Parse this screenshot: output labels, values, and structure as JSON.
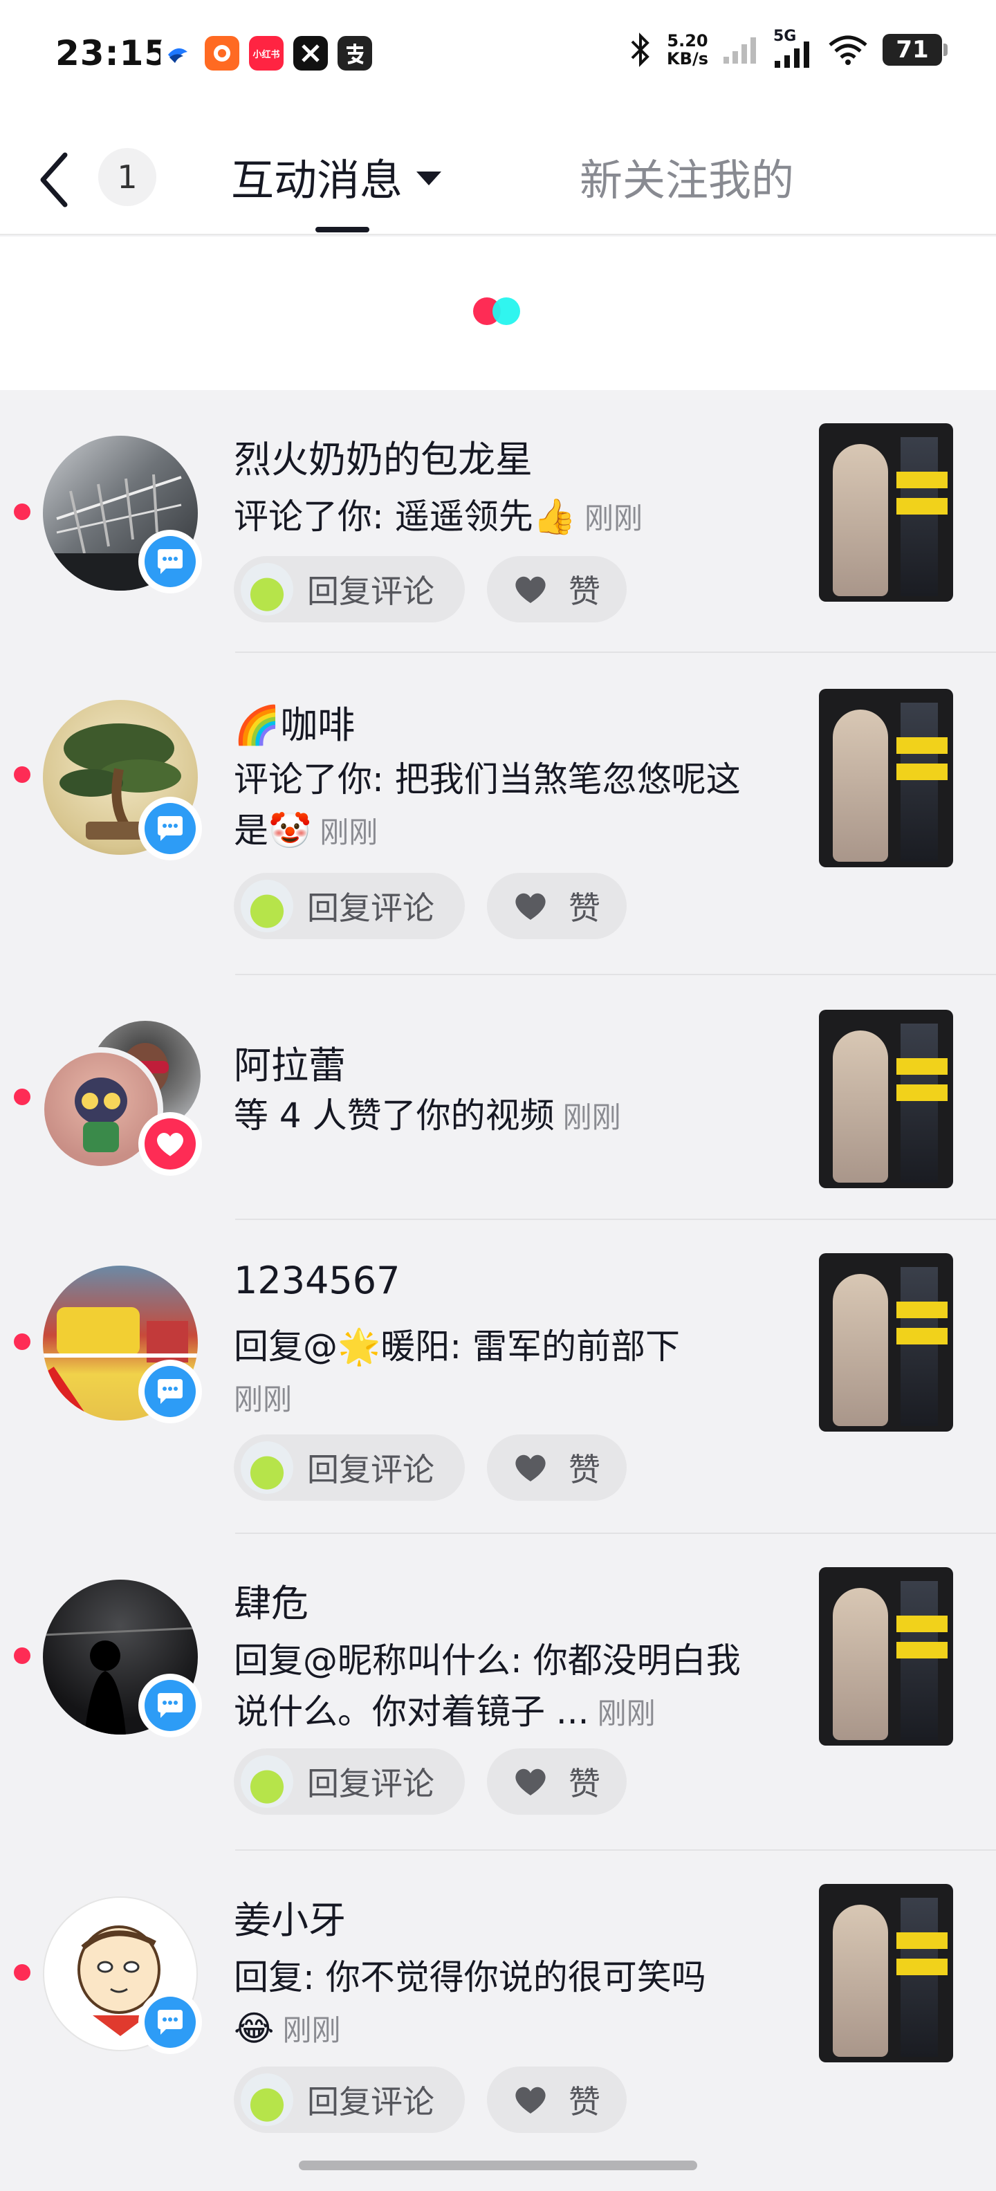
{
  "status_bar": {
    "time": "23:15",
    "app_icons": [
      "ticket-app-icon",
      "orange-app-icon",
      "小红书",
      "x-app-icon",
      "alipay-icon"
    ],
    "network_speed_value": "5.20",
    "network_speed_unit": "KB/s",
    "network_type": "5G",
    "battery": "71"
  },
  "header": {
    "unread_count": "1",
    "active_tab": "互动消息",
    "inactive_tab": "新关注我的"
  },
  "colors": {
    "accent_red": "#fe2c55",
    "accent_cyan": "#25f4ee",
    "badge_blue": "#2d9cf6"
  },
  "notifications": [
    {
      "name": "烈火奶奶的包龙星",
      "message": "评论了你: 遥遥领先",
      "message_emoji": "👍",
      "time": "刚刚",
      "badge": "comment",
      "reply_label": "回复评论",
      "like_label": "赞"
    },
    {
      "name": "咖啡",
      "name_emoji": "🌈",
      "message": "评论了你: 把我们当煞笔忽悠呢这是",
      "message_emoji": "🤡",
      "time": "刚刚",
      "badge": "comment",
      "reply_label": "回复评论",
      "like_label": "赞"
    },
    {
      "name": "阿拉蕾",
      "message": "等 4 人赞了你的视频",
      "time": "刚刚",
      "badge": "like"
    },
    {
      "name": "1234567",
      "message_prefix": "回复@",
      "message_emoji": "🌟",
      "message": "暖阳: 雷军的前部下",
      "time": "刚刚",
      "badge": "comment",
      "reply_label": "回复评论",
      "like_label": "赞"
    },
    {
      "name": "肆危",
      "message": "回复@昵称叫什么: 你都没明白我说什么。你对着镜子 ...",
      "time": "刚刚",
      "badge": "comment",
      "reply_label": "回复评论",
      "like_label": "赞"
    },
    {
      "name": "姜小牙",
      "message": "回复: 你不觉得你说的很可笑吗",
      "message_emoji": "😂",
      "time": "刚刚",
      "badge": "comment",
      "reply_label": "回复评论",
      "like_label": "赞"
    }
  ]
}
